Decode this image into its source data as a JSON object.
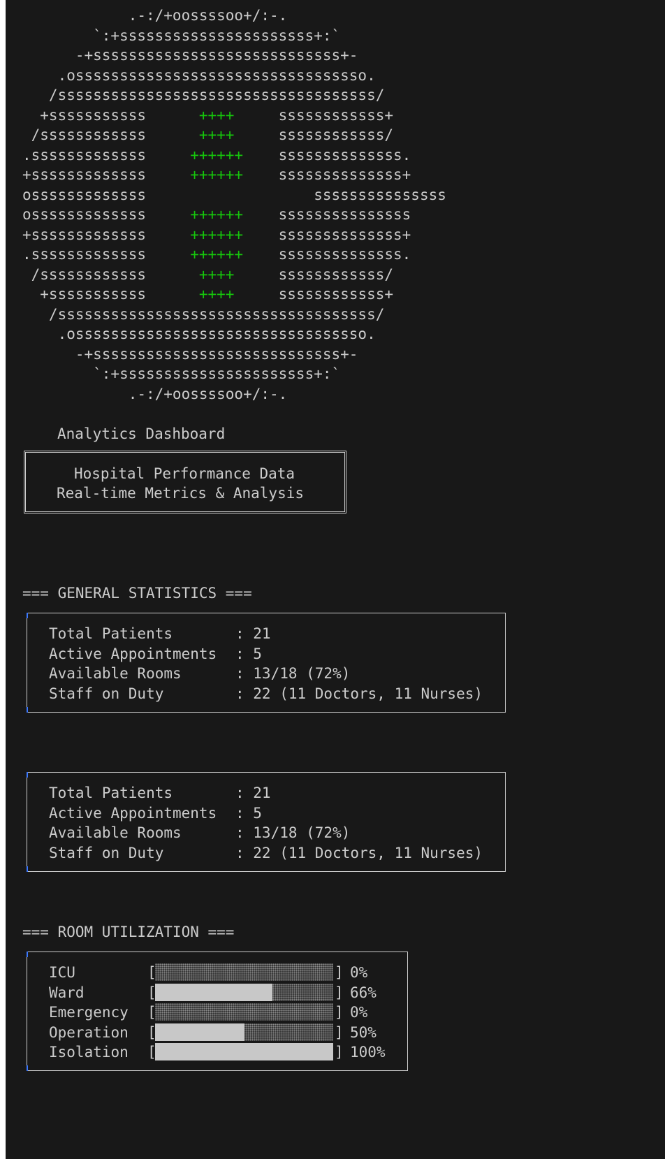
{
  "logo": {
    "lines": [
      {
        "pre": "            .-:/+oossssoo+/:-.",
        "plus": "",
        "post": ""
      },
      {
        "pre": "        `:+ssssssssssssssssssssss+:`",
        "plus": "",
        "post": ""
      },
      {
        "pre": "      -+ssssssssssssssssssssssssssss+-",
        "plus": "",
        "post": ""
      },
      {
        "pre": "    .osssssssssssssssssssssssssssssssso.",
        "plus": "",
        "post": ""
      },
      {
        "pre": "   /ssssssssssssssssssssssssssssssssssss/",
        "plus": "",
        "post": ""
      },
      {
        "pre": "  +sssssssssss      ",
        "plus": "++++",
        "post": "     ssssssssssss+"
      },
      {
        "pre": " /ssssssssssss      ",
        "plus": "++++",
        "post": "     ssssssssssss/"
      },
      {
        "pre": ".sssssssssssss     ",
        "plus": "++++++",
        "post": "    ssssssssssssss."
      },
      {
        "pre": "+sssssssssssss     ",
        "plus": "++++++",
        "post": "    ssssssssssssss+"
      },
      {
        "pre": "osssssssssssss                   sssssssssssssss",
        "plus": "",
        "post": ""
      },
      {
        "pre": "osssssssssssss     ",
        "plus": "++++++",
        "post": "    sssssssssssssss"
      },
      {
        "pre": "+sssssssssssss     ",
        "plus": "++++++",
        "post": "    ssssssssssssss+"
      },
      {
        "pre": ".sssssssssssss     ",
        "plus": "++++++",
        "post": "    ssssssssssssss."
      },
      {
        "pre": " /ssssssssssss      ",
        "plus": "++++",
        "post": "     ssssssssssss/"
      },
      {
        "pre": "  +sssssssssss      ",
        "plus": "++++",
        "post": "     ssssssssssss+"
      },
      {
        "pre": "   /ssssssssssssssssssssssssssssssssssss/",
        "plus": "",
        "post": ""
      },
      {
        "pre": "    .osssssssssssssssssssssssssssssssso.",
        "plus": "",
        "post": ""
      },
      {
        "pre": "      -+ssssssssssssssssssssssssssss+-",
        "plus": "",
        "post": ""
      },
      {
        "pre": "        `:+ssssssssssssssssssssss+:`",
        "plus": "",
        "post": ""
      },
      {
        "pre": "            .-:/+oossssoo+/:-.",
        "plus": "",
        "post": ""
      }
    ]
  },
  "app_title": "Analytics Dashboard",
  "title_box": {
    "line1": "Hospital Performance Data",
    "line2": "Real-time Metrics & Analysis"
  },
  "general_header": "=== GENERAL STATISTICS ===",
  "stats": [
    {
      "label": "Total Patients",
      "value": ": 21"
    },
    {
      "label": "Active Appointments",
      "value": ": 5"
    },
    {
      "label": "Available Rooms",
      "value": ": 13/18 (72%)"
    },
    {
      "label": "Staff on Duty",
      "value": ": 22 (11 Doctors, 11 Nurses)"
    }
  ],
  "room_header": "=== ROOM UTILIZATION ===",
  "rooms": [
    {
      "label": "ICU",
      "open": "[",
      "close": "]",
      "percent_text": "0%",
      "fill": 0.0
    },
    {
      "label": "Ward",
      "open": "[",
      "close": "]",
      "percent_text": "66%",
      "fill": 0.66
    },
    {
      "label": "Emergency",
      "open": "[",
      "close": "]",
      "percent_text": "0%",
      "fill": 0.0
    },
    {
      "label": "Operation",
      "open": "[",
      "close": "]",
      "percent_text": "50%",
      "fill": 0.5
    },
    {
      "label": "Isolation",
      "open": "[",
      "close": "]",
      "percent_text": "100%",
      "fill": 1.0
    }
  ],
  "colors": {
    "background": "#181818",
    "text": "#cccccc",
    "accent_green": "#16c60c",
    "bar_fill": "#c8c8c8",
    "corner_blue": "#3b78ff"
  }
}
